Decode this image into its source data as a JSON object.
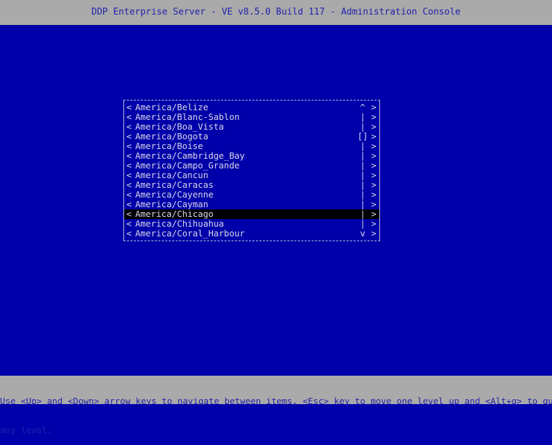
{
  "window": {
    "title": "DDP Enterprise Server - VE v8.5.0 Build 117 - Administration Console"
  },
  "colors": {
    "background": "#0000aa",
    "titlebar_bg": "#aaaaaa",
    "titlebar_fg": "#2222aa",
    "box_border": "#bfbfd8",
    "item_fg": "#d8d8e8",
    "selected_bg": "#000000",
    "statusbar_bg": "#aaaaaa",
    "statusbar_fg": "#2222aa"
  },
  "menu": {
    "left_arrow": "<",
    "right_arrow": ">",
    "scroll_up_glyph": "^",
    "scroll_down_glyph": "v",
    "scroll_track_glyph": "|",
    "scroll_thumb_glyph": "[]",
    "selected_index": 11,
    "items": [
      {
        "label": "America/Belize",
        "scroll": "^"
      },
      {
        "label": "America/Blanc-Sablon",
        "scroll": "|"
      },
      {
        "label": "America/Boa_Vista",
        "scroll": "|"
      },
      {
        "label": "America/Bogota",
        "scroll": "[]"
      },
      {
        "label": "America/Boise",
        "scroll": "|"
      },
      {
        "label": "America/Cambridge_Bay",
        "scroll": "|"
      },
      {
        "label": "America/Campo_Grande",
        "scroll": "|"
      },
      {
        "label": "America/Cancun",
        "scroll": "|"
      },
      {
        "label": "America/Caracas",
        "scroll": "|"
      },
      {
        "label": "America/Cayenne",
        "scroll": "|"
      },
      {
        "label": "America/Cayman",
        "scroll": "|"
      },
      {
        "label": "America/Chicago",
        "scroll": "|"
      },
      {
        "label": "America/Chihuahua",
        "scroll": "|"
      },
      {
        "label": "America/Coral_Harbour",
        "scroll": "v"
      }
    ]
  },
  "status": {
    "line1": "Use <Up> and <Down> arrow keys to navigate between items, <Esc> key to move one level up and <Alt+q> to quit at",
    "line2": "any level."
  }
}
